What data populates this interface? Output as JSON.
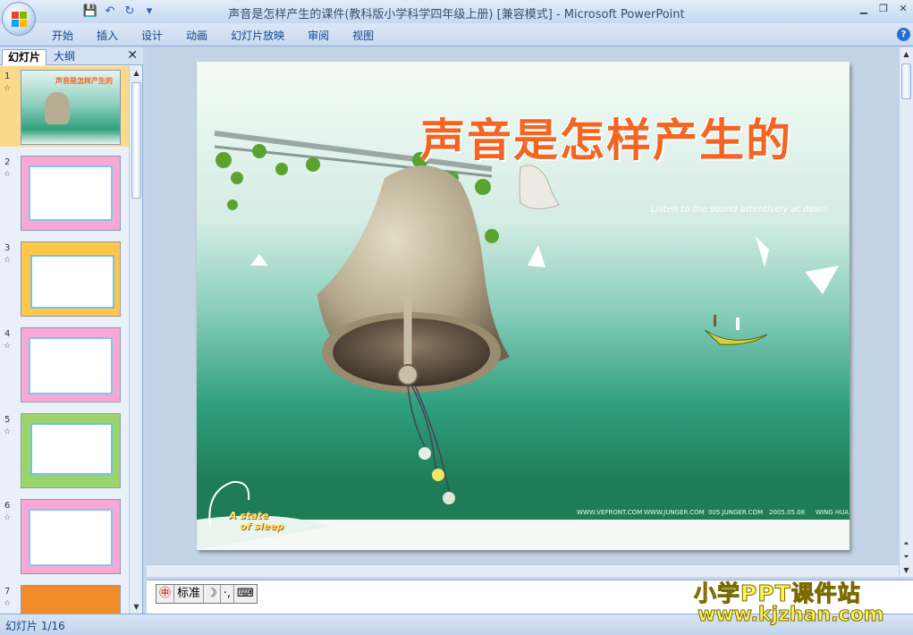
{
  "window": {
    "title": "声音是怎样产生的课件(教科版小学科学四年级上册) [兼容模式] - Microsoft PowerPoint"
  },
  "qat": {
    "save": "💾",
    "undo": "↶",
    "redo": "↻",
    "customize": "▾"
  },
  "ribbon": {
    "tabs": [
      "开始",
      "插入",
      "设计",
      "动画",
      "幻灯片放映",
      "审阅",
      "视图"
    ],
    "help": "?"
  },
  "left_pane": {
    "tab_slides": "幻灯片",
    "tab_outline": "大纲",
    "close": "✕",
    "thumbnails": [
      {
        "num": "1",
        "selected": true
      },
      {
        "num": "2",
        "selected": false
      },
      {
        "num": "3",
        "selected": false
      },
      {
        "num": "4",
        "selected": false
      },
      {
        "num": "5",
        "selected": false
      },
      {
        "num": "6",
        "selected": false
      },
      {
        "num": "7",
        "selected": false
      }
    ]
  },
  "slide": {
    "title": "声音是怎样产生的",
    "subtitle": "Listen to the sound attentively at dawn",
    "footer": [
      "WWW.VEFRONT.COM",
      "WWW.JUNGER.COM",
      "005.JUNGER.COM",
      "2005.05.08",
      "WING HUA"
    ],
    "logo_line1": "A state",
    "logo_line2": "of sleep"
  },
  "ime": {
    "label": "标准"
  },
  "status": {
    "text": "幻灯片 1/16"
  },
  "watermark": {
    "line1": "小学PPT课件站",
    "line2": "www.kjzhan.com"
  },
  "colors": {
    "title_orange": "#f26522",
    "sea_green": "#3aa882"
  }
}
